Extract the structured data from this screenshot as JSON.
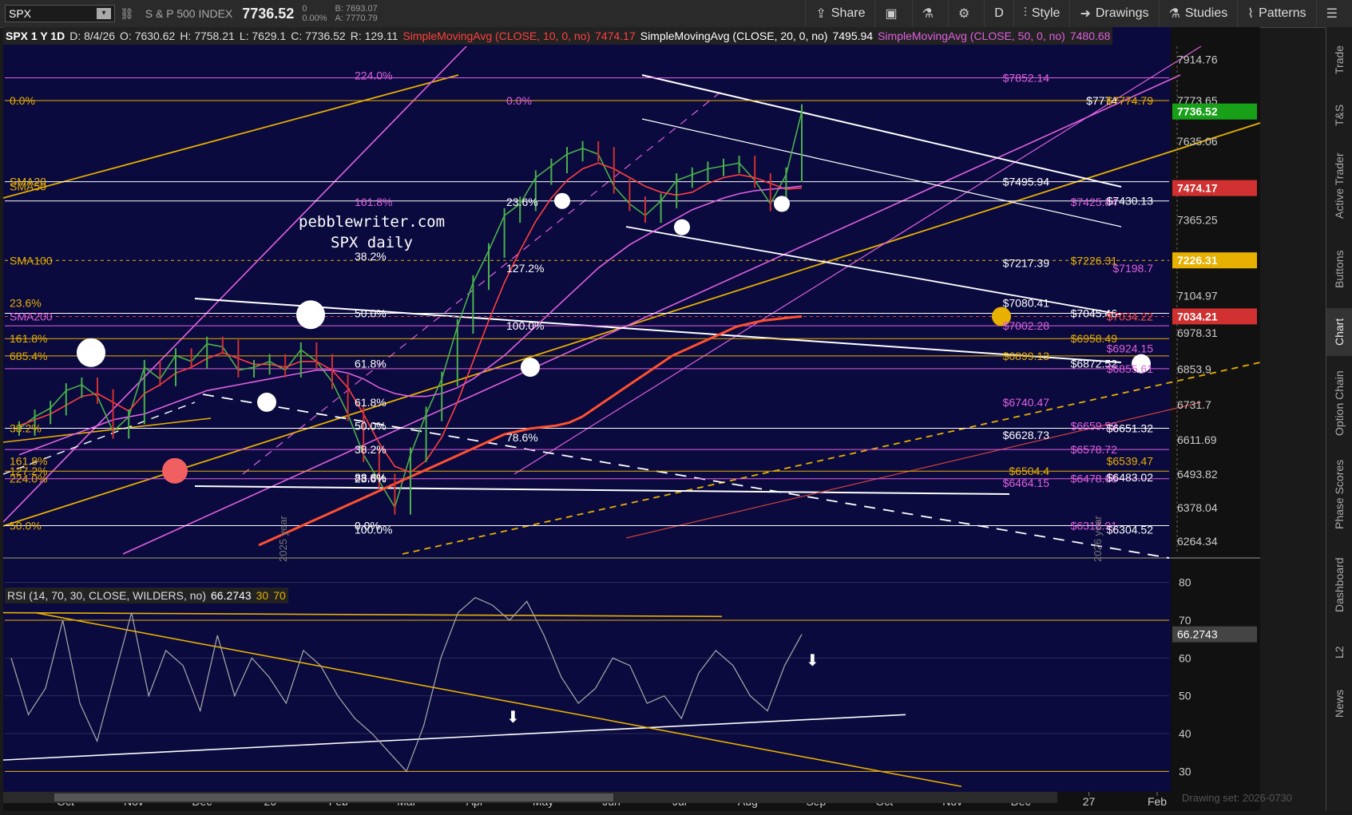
{
  "header": {
    "symbol": "SPX",
    "name": "S & P 500 INDEX",
    "price": "7736.52",
    "change": "0",
    "change_pct": "0.00%",
    "bid": "B: 7693.07",
    "ask": "A: 7770.79",
    "buttons": {
      "share": "Share",
      "period": "D",
      "style": "Style",
      "drawings": "Drawings",
      "studies": "Studies",
      "patterns": "Patterns"
    }
  },
  "info": {
    "title": "SPX 1 Y 1D",
    "date": "D: 8/4/26",
    "open": "O: 7630.62",
    "high": "H: 7758.21",
    "low": "L: 7629.1",
    "close": "C: 7736.52",
    "range": "R: 129.11",
    "sma10_label": "SimpleMovingAvg (CLOSE, 10, 0, no)",
    "sma10_val": "7474.17",
    "sma20_label": "SimpleMovingAvg (CLOSE, 20, 0, no)",
    "sma20_val": "7495.94",
    "sma50_label": "SimpleMovingAvg (CLOSE, 50, 0, no)",
    "sma50_val": "7480.68"
  },
  "rsi": {
    "label": "RSI (14, 70, 30, CLOSE, WILDERS, no)",
    "value": "66.2743",
    "ob": "30",
    "os": "70"
  },
  "watermark": {
    "line1": "pebblewriter.com",
    "line2": "SPX daily"
  },
  "right_tabs": [
    "Trade",
    "T&S",
    "Active Trader",
    "Buttons",
    "Chart",
    "Option Chain",
    "Phase Scores",
    "Dashboard",
    "L2",
    "News"
  ],
  "drawing_set": "Drawing set: 2026-0730",
  "colors": {
    "bg": "#0c0c3c",
    "white": "#ffffff",
    "magenta": "#e060e0",
    "orange": "#e8b000",
    "red": "#e05050",
    "green": "#4ab04a"
  },
  "chart_data": {
    "type": "line",
    "price_axis": {
      "ticks": [
        "7914.76",
        "7773.65",
        "7635.06",
        "7365.25",
        "7104.97",
        "6978.31",
        "6853.9",
        "6731.7",
        "6611.69",
        "6493.82",
        "6378.04",
        "6264.34"
      ],
      "ylim": [
        6220,
        7960
      ]
    },
    "x_ticks": [
      "Oct",
      "Nov",
      "Dec",
      "26",
      "Feb",
      "Mar",
      "Apr",
      "May",
      "Jun",
      "Jul",
      "Aug",
      "Sep",
      "Oct",
      "Nov",
      "Dec",
      "27",
      "Feb"
    ],
    "year_labels": [
      "2025 year",
      "2026 year"
    ],
    "price_badges": [
      {
        "value": "7736.52",
        "color": "#18a018"
      },
      {
        "value": "7474.17",
        "color": "#d03030"
      },
      {
        "value": "7226.31",
        "color": "#e8b000"
      },
      {
        "value": "7034.21",
        "color": "#d03030"
      }
    ],
    "series": [
      {
        "name": "SPX",
        "values": [
          6650,
          6690,
          6720,
          6780,
          6800,
          6760,
          6640,
          6690,
          6860,
          6820,
          6900,
          6880,
          6940,
          6930,
          6850,
          6860,
          6880,
          6850,
          6920,
          6880,
          6810,
          6700,
          6560,
          6470,
          6380,
          6560,
          6700,
          6820,
          7000,
          7150,
          7260,
          7380,
          7420,
          7510,
          7550,
          7590,
          7610,
          7590,
          7480,
          7420,
          7380,
          7430,
          7500,
          7520,
          7540,
          7550,
          7560,
          7500,
          7420,
          7520,
          7736.52
        ]
      },
      {
        "name": "SMA10",
        "values": [
          6660,
          6680,
          6700,
          6730,
          6760,
          6770,
          6740,
          6710,
          6770,
          6800,
          6840,
          6860,
          6890,
          6910,
          6890,
          6870,
          6870,
          6860,
          6880,
          6880,
          6850,
          6790,
          6700,
          6600,
          6520,
          6500,
          6540,
          6620,
          6740,
          6880,
          7020,
          7150,
          7260,
          7360,
          7440,
          7500,
          7540,
          7560,
          7540,
          7510,
          7480,
          7460,
          7450,
          7460,
          7490,
          7510,
          7520,
          7510,
          7490,
          7470,
          7474.17
        ]
      },
      {
        "name": "SMA50",
        "values": [
          6560,
          6580,
          6600,
          6620,
          6640,
          6660,
          6680,
          6690,
          6700,
          6720,
          6740,
          6760,
          6780,
          6790,
          6800,
          6810,
          6820,
          6830,
          6840,
          6850,
          6850,
          6840,
          6820,
          6790,
          6770,
          6760,
          6760,
          6770,
          6790,
          6820,
          6860,
          6900,
          6950,
          7000,
          7050,
          7100,
          7150,
          7200,
          7240,
          7280,
          7310,
          7340,
          7370,
          7400,
          7420,
          7440,
          7455,
          7465,
          7470,
          7475,
          7480.68
        ]
      },
      {
        "name": "SMA200",
        "values": [
          6250,
          6270,
          6290,
          6310,
          6330,
          6350,
          6370,
          6390,
          6410,
          6430,
          6450,
          6470,
          6490,
          6510,
          6530,
          6550,
          6570,
          6590,
          6610,
          6630,
          6640,
          6650,
          6655,
          6660,
          6670,
          6690,
          6720,
          6750,
          6780,
          6810,
          6840,
          6870,
          6900,
          6920,
          6940,
          6960,
          6980,
          7000,
          7010,
          7020,
          7025,
          7030,
          7034.21
        ]
      }
    ],
    "rsi_values": [
      60,
      45,
      52,
      70,
      48,
      38,
      55,
      72,
      50,
      62,
      58,
      46,
      66,
      50,
      60,
      55,
      48,
      62,
      58,
      50,
      44,
      40,
      35,
      30,
      42,
      60,
      72,
      76,
      74,
      70,
      75,
      66,
      55,
      48,
      52,
      60,
      58,
      48,
      50,
      44,
      56,
      62,
      58,
      50,
      46,
      58,
      66.27
    ],
    "rsi_axis": {
      "ticks": [
        "80",
        "70",
        "60",
        "50",
        "40",
        "30"
      ],
      "ylim": [
        25,
        85
      ]
    },
    "price_labels": [
      {
        "text": "$7852.14",
        "price": 7852
      },
      {
        "text": "$7774",
        "price": 7774
      },
      {
        "text": "$7774.79",
        "price": 7774
      },
      {
        "text": "$7495.94",
        "price": 7496
      },
      {
        "text": "$7425.84",
        "price": 7426
      },
      {
        "text": "$7430.13",
        "price": 7430
      },
      {
        "text": "$7217.39",
        "price": 7217
      },
      {
        "text": "$7226.31",
        "price": 7226
      },
      {
        "text": "$7198.7",
        "price": 7199
      },
      {
        "text": "$7080.41",
        "price": 7080
      },
      {
        "text": "$7045.46",
        "price": 7045
      },
      {
        "text": "$7034.22",
        "price": 7034
      },
      {
        "text": "$7002.28",
        "price": 7002
      },
      {
        "text": "$6958.49",
        "price": 6958
      },
      {
        "text": "$6924.15",
        "price": 6924
      },
      {
        "text": "$6899.13",
        "price": 6899
      },
      {
        "text": "$6872.52",
        "price": 6872
      },
      {
        "text": "$6855.61",
        "price": 6855
      },
      {
        "text": "$6740.47",
        "price": 6740
      },
      {
        "text": "$6659.59",
        "price": 6659
      },
      {
        "text": "$6651.32",
        "price": 6651
      },
      {
        "text": "$6628.73",
        "price": 6628
      },
      {
        "text": "$6578.72",
        "price": 6578
      },
      {
        "text": "$6539.47",
        "price": 6539
      },
      {
        "text": "$6504.4",
        "price": 6504
      },
      {
        "text": "$6478.66",
        "price": 6478
      },
      {
        "text": "$6483.02",
        "price": 6483
      },
      {
        "text": "$6464.15",
        "price": 6464
      },
      {
        "text": "$6316.91",
        "price": 6317
      },
      {
        "text": "$6304.52",
        "price": 6304
      }
    ],
    "fib_labels": [
      {
        "text": "224.0%",
        "price": 7860
      },
      {
        "text": "0.0%",
        "price": 7774
      },
      {
        "text": "161.8%",
        "price": 7426
      },
      {
        "text": "23.6%",
        "price": 7426
      },
      {
        "text": "38.2%",
        "price": 7240
      },
      {
        "text": "127.2%",
        "price": 7200
      },
      {
        "text": "50.0%",
        "price": 7045
      },
      {
        "text": "100.0%",
        "price": 7002
      },
      {
        "text": "61.8%",
        "price": 6872
      },
      {
        "text": "78.6%",
        "price": 6620
      },
      {
        "text": "88.6%",
        "price": 6483
      },
      {
        "text": "100.0%",
        "price": 6304
      },
      {
        "text": "61.8%",
        "price": 6740
      },
      {
        "text": "50.0%",
        "price": 6659
      },
      {
        "text": "38.2%",
        "price": 6578
      },
      {
        "text": "23.6%",
        "price": 6478
      },
      {
        "text": "0.0%",
        "price": 6317
      }
    ],
    "left_labels": [
      {
        "text": "0.0%",
        "price": 7774
      },
      {
        "text": "SMA20",
        "price": 7496
      },
      {
        "text": "SMA50",
        "price": 7480
      },
      {
        "text": "SMA100",
        "price": 7226
      },
      {
        "text": "23.6%",
        "price": 7080
      },
      {
        "text": "SMA200",
        "price": 7034
      },
      {
        "text": "161.8%",
        "price": 6958
      },
      {
        "text": "685.4%",
        "price": 6899
      },
      {
        "text": "38.2%",
        "price": 6651
      },
      {
        "text": "161.8%",
        "price": 6539
      },
      {
        "text": "127.2%",
        "price": 6504
      },
      {
        "text": "224.0%",
        "price": 6478
      },
      {
        "text": "50.0%",
        "price": 6317
      }
    ]
  }
}
